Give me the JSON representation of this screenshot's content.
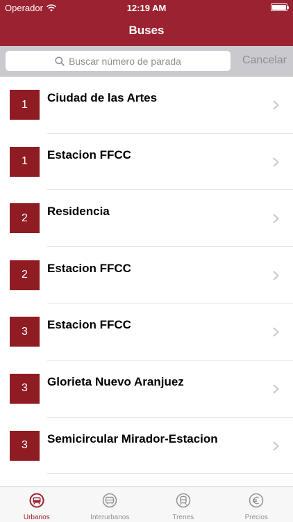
{
  "status": {
    "carrier": "Operador",
    "time": "12:19 AM"
  },
  "nav": {
    "title": "Buses"
  },
  "search": {
    "placeholder": "Buscar número de parada",
    "cancel": "Cancelar"
  },
  "routes": [
    {
      "line": "1",
      "name": "Ciudad de las Artes"
    },
    {
      "line": "1",
      "name": "Estacion FFCC"
    },
    {
      "line": "2",
      "name": "Residencia"
    },
    {
      "line": "2",
      "name": "Estacion FFCC"
    },
    {
      "line": "3",
      "name": "Estacion FFCC"
    },
    {
      "line": "3",
      "name": "Glorieta Nuevo Aranjuez"
    },
    {
      "line": "3",
      "name": "Semicircular Mirador-Estacion"
    }
  ],
  "tabs": [
    {
      "label": "Urbanos",
      "icon": "bus-icon",
      "active": true
    },
    {
      "label": "Interurbanos",
      "icon": "intercity-bus-icon",
      "active": false
    },
    {
      "label": "Trenes",
      "icon": "train-icon",
      "active": false
    },
    {
      "label": "Precios",
      "icon": "euro-icon",
      "active": false
    }
  ],
  "colors": {
    "accent": "#9b2230",
    "badge": "#8f1c22",
    "inactive": "#929292"
  }
}
